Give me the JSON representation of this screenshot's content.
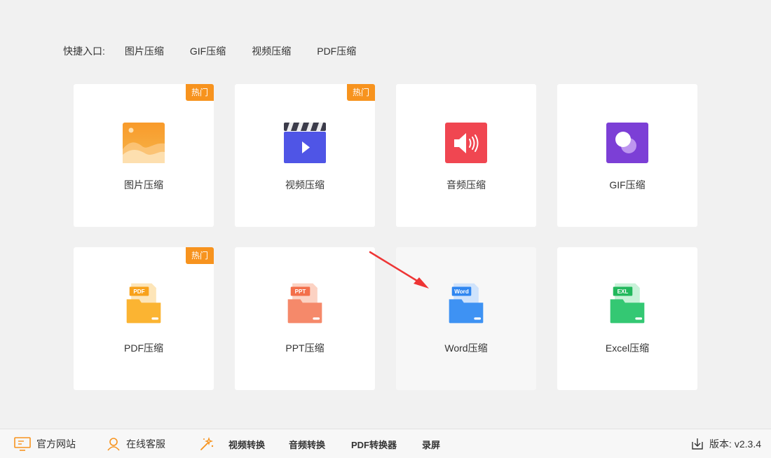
{
  "quick_entry": {
    "label": "快捷入口:",
    "links": [
      "图片压缩",
      "GIF压缩",
      "视频压缩",
      "PDF压缩"
    ]
  },
  "tiles": [
    {
      "label": "图片压缩",
      "badge": "热门",
      "icon": "image-icon",
      "color": "#f7931e"
    },
    {
      "label": "视频压缩",
      "badge": "热门",
      "icon": "video-icon",
      "color": "#4f5de0"
    },
    {
      "label": "音频压缩",
      "badge": "",
      "icon": "audio-icon",
      "color": "#f04651"
    },
    {
      "label": "GIF压缩",
      "badge": "",
      "icon": "gif-icon",
      "color": "#7c3fd6"
    },
    {
      "label": "PDF压缩",
      "badge": "热门",
      "icon": "pdf-file-icon",
      "tag": "PDF",
      "color": "#f8a81a"
    },
    {
      "label": "PPT压缩",
      "badge": "",
      "icon": "ppt-file-icon",
      "tag": "PPT",
      "color": "#f2714f"
    },
    {
      "label": "Word压缩",
      "badge": "",
      "icon": "word-file-icon",
      "tag": "Word",
      "color": "#2f86f0"
    },
    {
      "label": "Excel压缩",
      "badge": "",
      "icon": "excel-file-icon",
      "tag": "EXL",
      "color": "#28c266"
    }
  ],
  "footer": {
    "website": "官方网站",
    "support": "在线客服",
    "tools": [
      "视频转换",
      "音频转换",
      "PDF转换器",
      "录屏"
    ],
    "version_label": "版本:",
    "version": "v2.3.4"
  }
}
